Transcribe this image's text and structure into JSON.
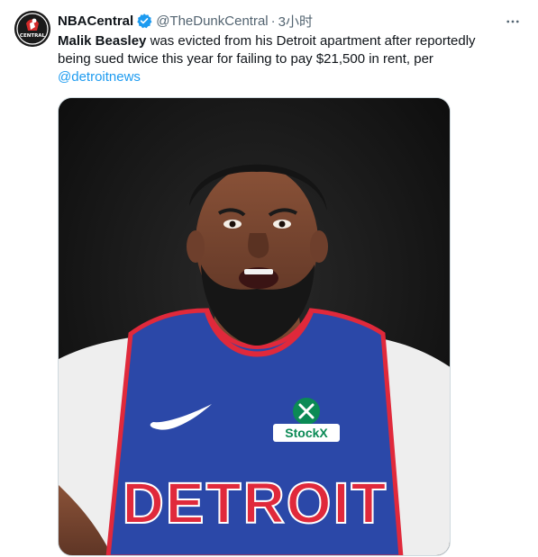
{
  "tweet": {
    "author": {
      "display_name": "NBACentral",
      "handle": "@TheDunkCentral",
      "verified": true,
      "avatar_label": "CENTRAL"
    },
    "separator": "·",
    "timestamp": "3小时",
    "text": {
      "bold_name": "Malik Beasley",
      "body": " was evicted from his Detroit apartment after reportedly being sued twice this year for failing to pay $21,500 in rent, per ",
      "mention": "@detroitnews"
    },
    "media": {
      "jersey_text": "DETROIT",
      "sponsor_text": "StockX"
    }
  },
  "colors": {
    "link": "#1d9bf0",
    "secondary": "#536471",
    "verified": "#1d9bf0",
    "jersey_blue": "#2b48a8",
    "jersey_red": "#e0293b"
  }
}
